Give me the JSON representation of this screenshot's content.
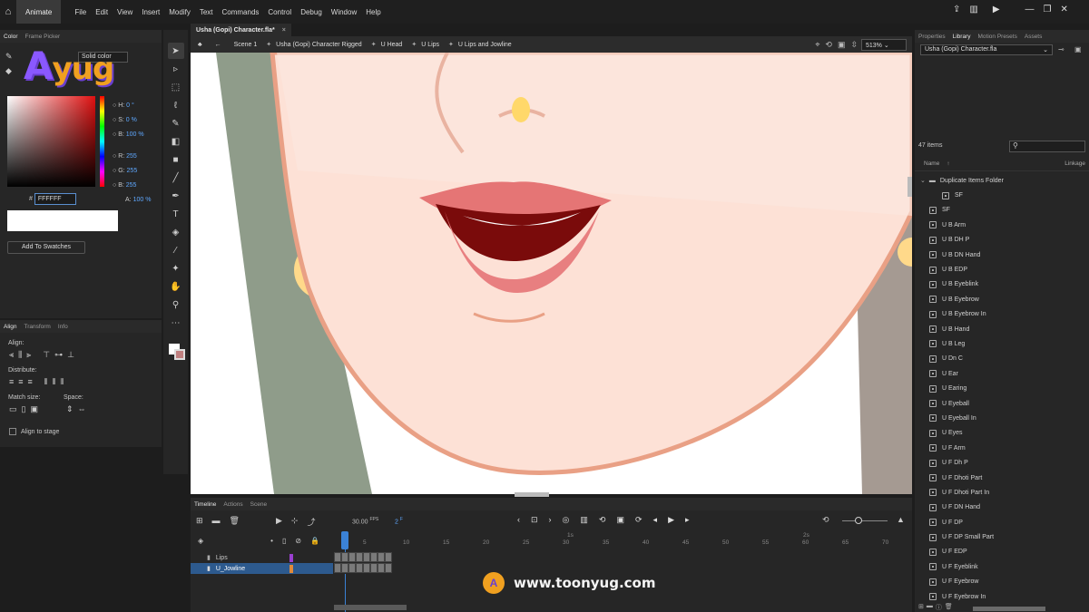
{
  "app": {
    "name": "Animate"
  },
  "menu": [
    "File",
    "Edit",
    "View",
    "Insert",
    "Modify",
    "Text",
    "Commands",
    "Control",
    "Debug",
    "Window",
    "Help"
  ],
  "document_tab": {
    "title": "Usha (Gopi) Character.fla*",
    "close": "×"
  },
  "breadcrumb": [
    "Scene 1",
    "Usha (Gopi) Character Rigged",
    "U Head",
    "U Lips",
    "U Lips and Jowline"
  ],
  "zoom": "513%",
  "color_panel": {
    "tabs": [
      "Color",
      "Frame Picker"
    ],
    "type": "Solid color",
    "h_label": "H:",
    "h": "0 °",
    "s_label": "S:",
    "s": "0 %",
    "b_label": "B:",
    "b": "100 %",
    "r_label": "R:",
    "r": "255",
    "g_label": "G:",
    "g": "255",
    "bl_label": "B:",
    "bl": "255",
    "a_label": "A:",
    "a": "100 %",
    "hex_prefix": "#",
    "hex": "FFFFFF",
    "add_swatches": "Add To Swatches"
  },
  "align_panel": {
    "tabs": [
      "Align",
      "Transform",
      "Info"
    ],
    "align_label": "Align:",
    "distribute_label": "Distribute:",
    "match_size_label": "Match size:",
    "space_label": "Space:",
    "align_to_stage": "Align to stage"
  },
  "right_panel": {
    "tabs": [
      "Properties",
      "Library",
      "Motion Presets",
      "Assets"
    ],
    "document": "Usha (Gopi) Character.fla",
    "item_count": "47 items",
    "col_name": "Name",
    "col_linkage": "Linkage",
    "items": [
      "Duplicate Items Folder",
      "SF",
      "SF",
      "U B Arm",
      "U B DH P",
      "U B DN Hand",
      "U B EDP",
      "U B Eyeblink",
      "U B Eyebrow",
      "U B Eyebrow In",
      "U B Hand",
      "U B Leg",
      "U Dn C",
      "U Ear",
      "U Earing",
      "U Eyeball",
      "U Eyeball In",
      "U Eyes",
      "U F Arm",
      "U F Dh P",
      "U F Dhoti Part",
      "U F Dhoti Part In",
      "U F DN Hand",
      "U F DP",
      "U F DP Small Part",
      "U F EDP",
      "U F Eyeblink",
      "U F Eyebrow",
      "U F Eyebrow In"
    ]
  },
  "timeline": {
    "tabs": [
      "Timeline",
      "Actions",
      "Scene"
    ],
    "fps": "30.00",
    "fps_label": "FPS",
    "frame": "2",
    "frame_suffix": "F",
    "layers": [
      "Lips",
      "U_Jowline"
    ],
    "ruler": [
      "1s",
      "5",
      "10",
      "15",
      "20",
      "25",
      "30",
      "35",
      "40",
      "45",
      "50",
      "55",
      "2s",
      "60",
      "65",
      "70"
    ]
  },
  "watermark": {
    "logo": "Ayug",
    "url": "www.toonyug.com"
  },
  "colors": {
    "accent": "#2d5a8e",
    "skin": "#fde1d6",
    "outline": "#e9a085",
    "bg_green": "#8f9c8a",
    "lip": "#e57575"
  }
}
